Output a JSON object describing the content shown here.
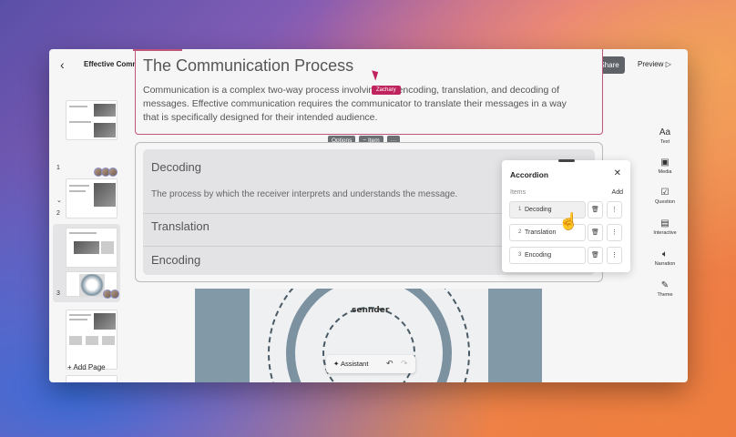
{
  "topbar": {
    "doc_title": "Effective Communication Skills in the Wor...",
    "share_label": "Share",
    "preview_label": "Preview"
  },
  "sidebar": {
    "slide_numbers": [
      "1",
      "2",
      "3"
    ],
    "add_page_label": "Add Page"
  },
  "slide": {
    "title": "The Communication Process",
    "body": "Communication is a complex two-way process involving the encoding, translation, and decoding of messages. Effective communication requires the communicator to translate their messages in a way that is specifically designed for their intended audience.",
    "cursor_label": "Zachary"
  },
  "mini_toolbar": {
    "options": "Options",
    "item": "Item",
    "more": "···"
  },
  "accordion": {
    "items": [
      {
        "title": "Decoding",
        "description": "The process by which the receiver interprets and understands the message."
      },
      {
        "title": "Translation"
      },
      {
        "title": "Encoding"
      }
    ]
  },
  "image": {
    "caption": "sennder"
  },
  "assistant": {
    "label": "Assistant"
  },
  "rail": {
    "text": "Text",
    "media": "Media",
    "question": "Question",
    "interactive": "Interactive",
    "narration": "Narration",
    "theme": "Theme"
  },
  "panel": {
    "title": "Accordion",
    "items_label": "Items",
    "add_label": "Add",
    "rows": [
      {
        "num": "1",
        "label": "Decoding"
      },
      {
        "num": "2",
        "label": "Translation"
      },
      {
        "num": "3",
        "label": "Encoding"
      }
    ]
  },
  "colors": {
    "accent": "#c0245e",
    "share_bg": "#5f6368"
  }
}
